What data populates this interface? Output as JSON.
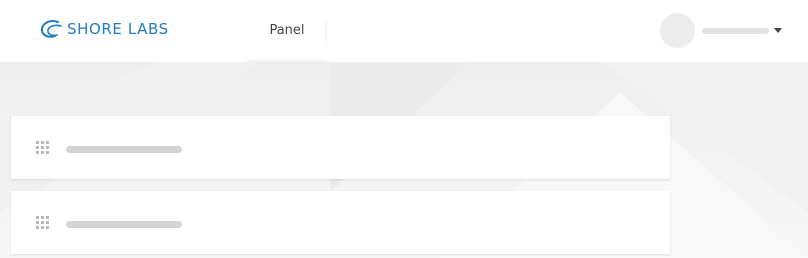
{
  "header": {
    "logo_text": "SHORE LABS",
    "brand_color": "#1f7dc1",
    "nav": [
      {
        "label": "Panel",
        "active": true
      }
    ],
    "user_menu": {
      "avatar_icon": "avatar-placeholder",
      "name": "",
      "dropdown_icon": "caret-down-icon"
    }
  },
  "main": {
    "cards": [
      {
        "handle_icon": "drag-handle-icon",
        "title": ""
      },
      {
        "handle_icon": "drag-handle-icon",
        "title": ""
      }
    ]
  }
}
